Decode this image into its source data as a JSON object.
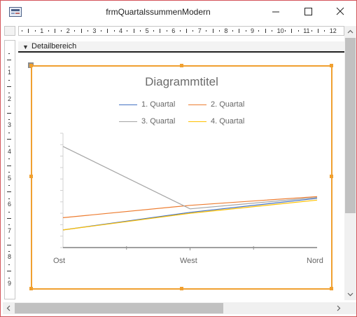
{
  "window": {
    "title": "frmQuartalssummenModern"
  },
  "ruler": {
    "h_numbers": [
      "1",
      "2",
      "3",
      "4",
      "5",
      "6",
      "7",
      "8",
      "9",
      "10",
      "11",
      "12"
    ],
    "v_numbers": [
      "1",
      "2",
      "3",
      "4",
      "5",
      "6",
      "7",
      "8",
      "9"
    ]
  },
  "section": {
    "label": "Detailbereich"
  },
  "chart_data": {
    "type": "line",
    "title": "Diagrammtitel",
    "categories": [
      "Ost",
      "West",
      "Nord"
    ],
    "series": [
      {
        "name": "1. Quartal",
        "color": "#4472c4",
        "values": [
          20,
          40,
          56
        ]
      },
      {
        "name": "2. Quartal",
        "color": "#ed7d31",
        "values": [
          34,
          48,
          58
        ]
      },
      {
        "name": "3. Quartal",
        "color": "#a5a5a5",
        "values": [
          115,
          44,
          57
        ]
      },
      {
        "name": "4. Quartal",
        "color": "#ffc000",
        "values": [
          20,
          39,
          54
        ]
      }
    ],
    "ylim": [
      0,
      130
    ],
    "legend": "top",
    "grid": false
  },
  "icons": {
    "app": "form-icon",
    "minimize": "minimize-icon",
    "maximize": "maximize-icon",
    "close": "close-icon",
    "section": "section-arrow-icon"
  }
}
